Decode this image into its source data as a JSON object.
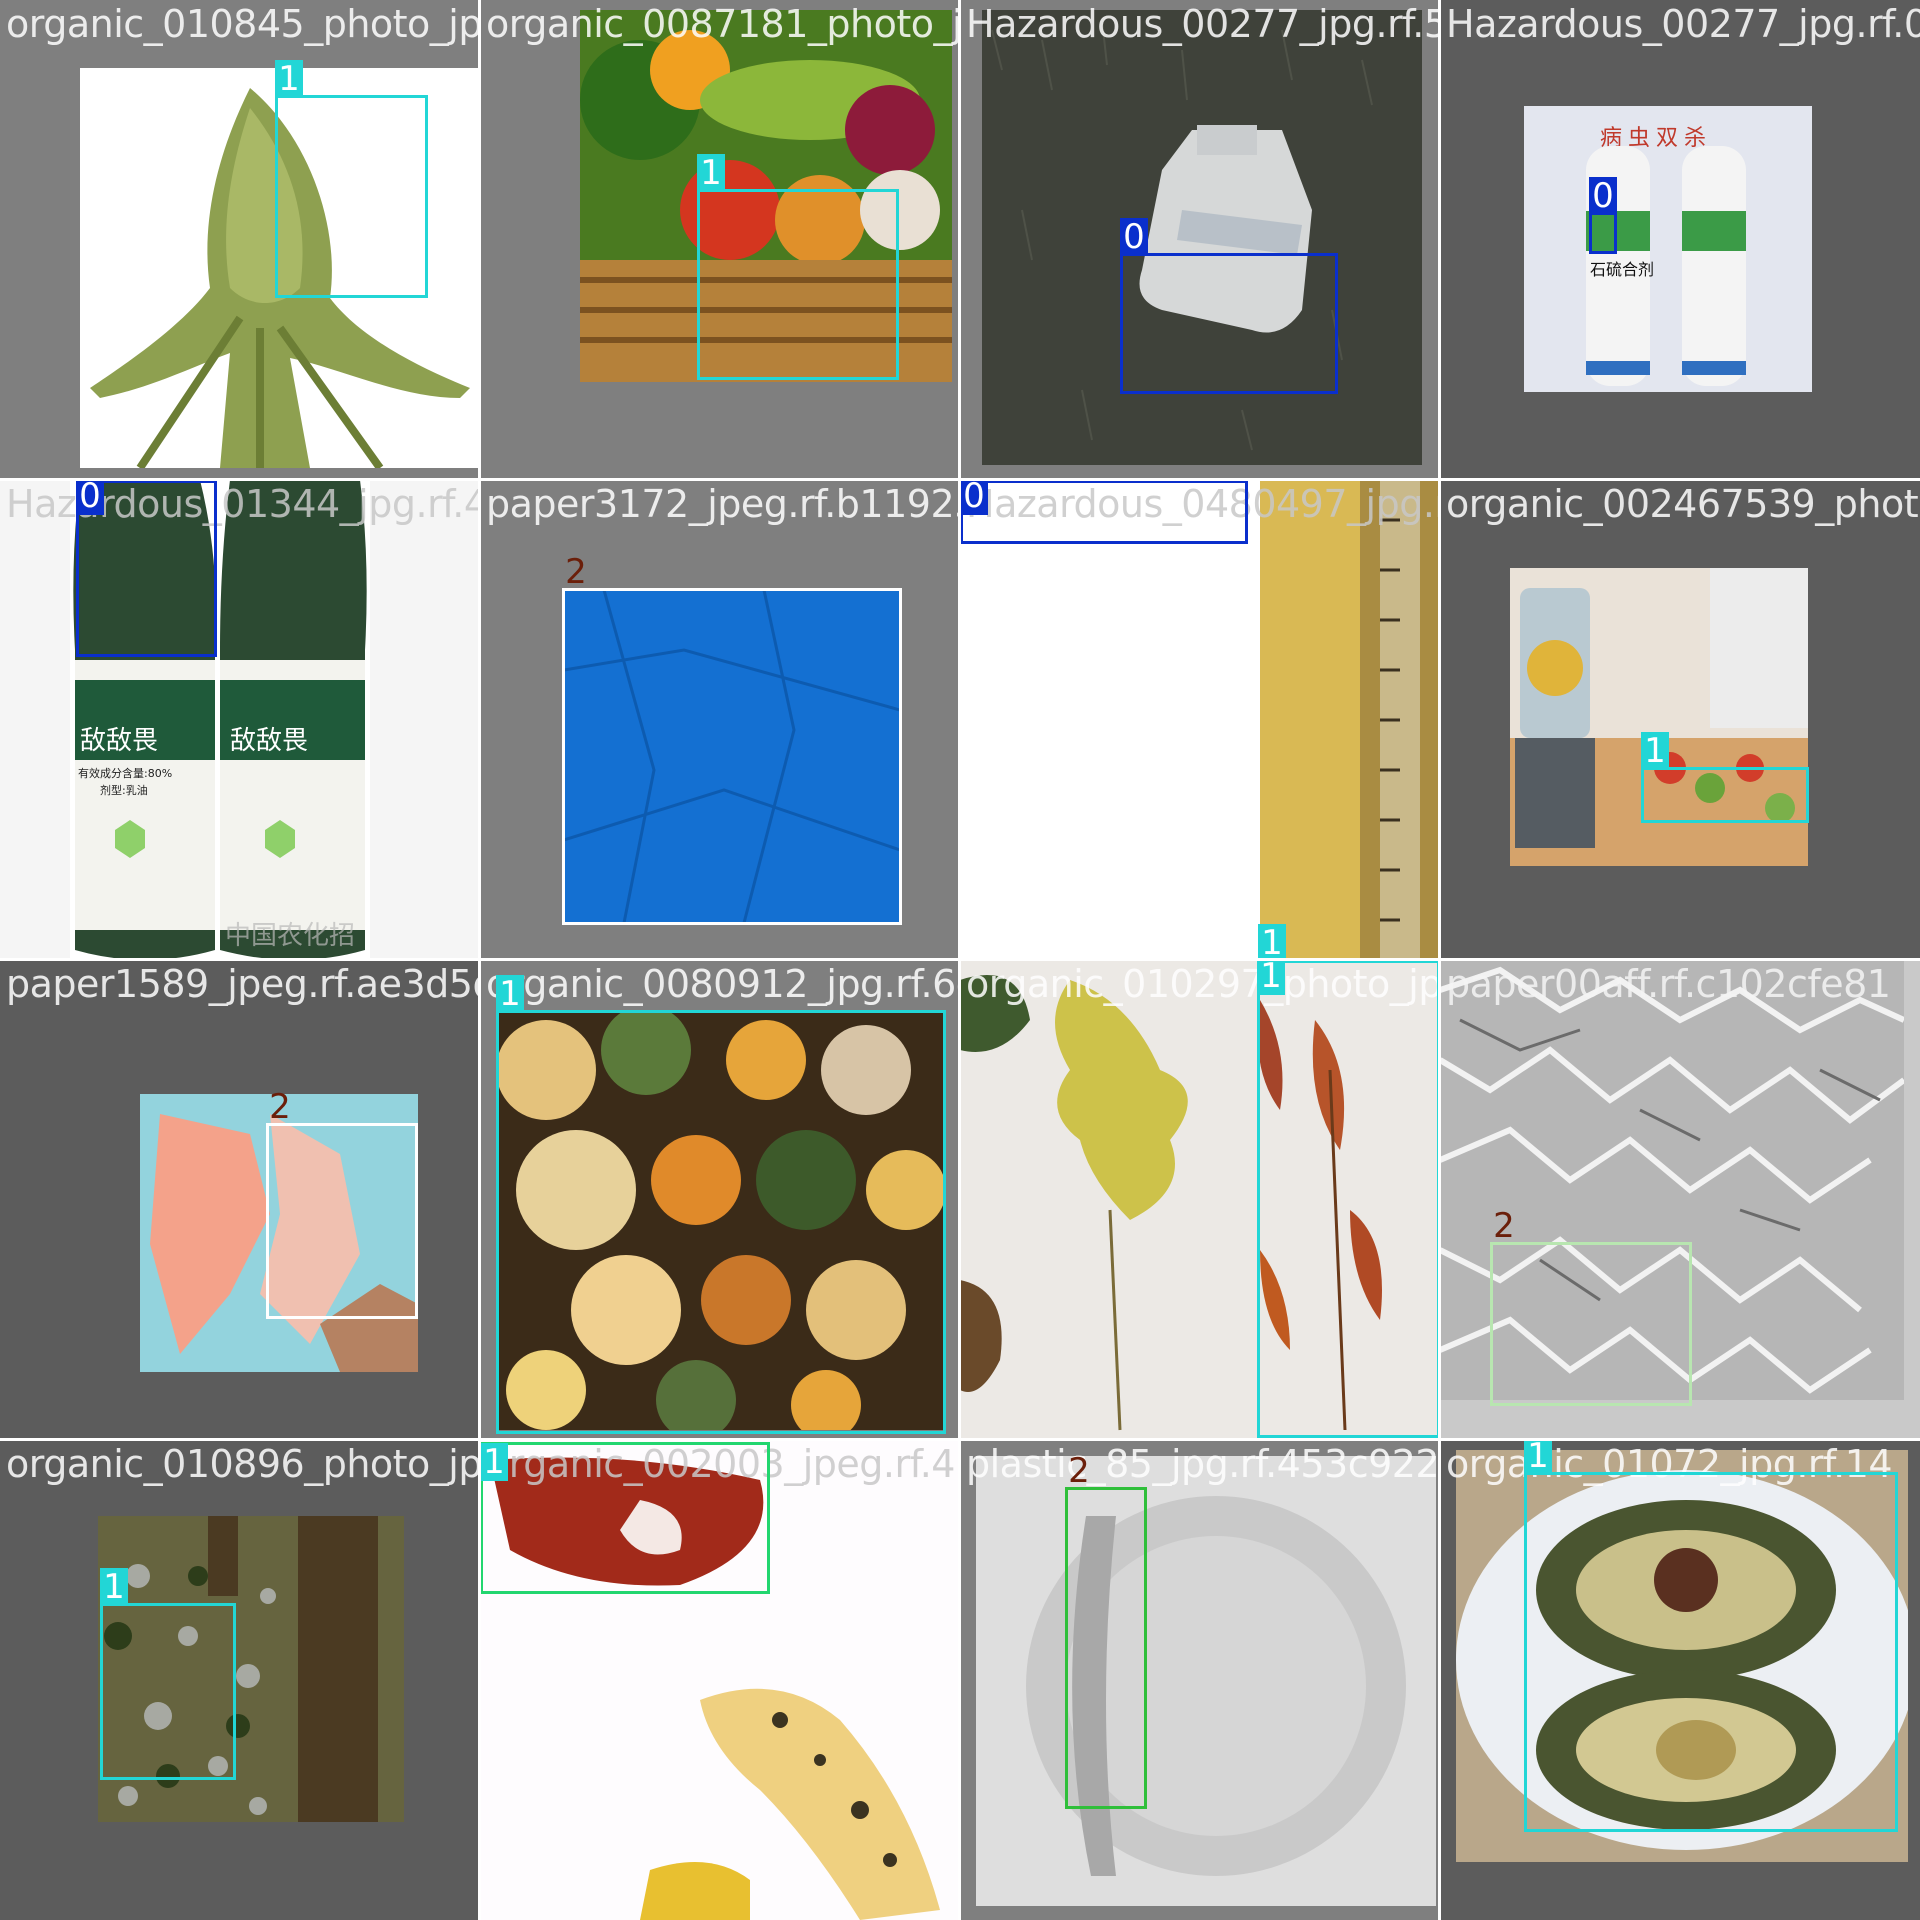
{
  "tiles": [
    {
      "filename": "organic_010845_photo_jpg.rf.cab0b48741f04",
      "boxes": [
        {
          "label": "1"
        }
      ]
    },
    {
      "filename": "organic_0087181_photo_jpg.rf.e8a123",
      "boxes": [
        {
          "label": "1"
        }
      ]
    },
    {
      "filename": "Hazardous_00277_jpg.rf.5c6eae6bb40a63749",
      "boxes": [
        {
          "label": "0"
        }
      ]
    },
    {
      "filename": "Hazardous_00277_jpg.rf.0ec",
      "boxes": [
        {
          "label": "0"
        }
      ],
      "product_text": {
        "headline": "病虫双杀",
        "name": "石硫合剂"
      }
    },
    {
      "filename": "Hazardous_01344_jpg.rf.420c9e5172838a2 1f.b119256",
      "boxes": [
        {
          "label": "0"
        }
      ],
      "product_text": {
        "name": "敌敌畏",
        "content": "有效成分含量:80%",
        "form": "剂型:乳油",
        "watermark": "中国农化招商网"
      }
    },
    {
      "filename": "paper3172_jpeg.rf.b119256f",
      "boxes": [
        {
          "label": "2"
        }
      ]
    },
    {
      "filename": "Hazardous_0480497_jpg.rf.7ec1236d",
      "boxes": [
        {
          "label": "0"
        },
        {
          "label": "1"
        }
      ]
    },
    {
      "filename": "organic_002467539_photo_jpg.r",
      "boxes": [
        {
          "label": "1"
        }
      ]
    },
    {
      "filename": "paper1589_jpeg.rf.ae3d5de1b",
      "boxes": [
        {
          "label": "2"
        }
      ]
    },
    {
      "filename": "organic_0080912_jpg.rf.6d5c853",
      "boxes": [
        {
          "label": "1"
        }
      ]
    },
    {
      "filename": "organic_010297_photo_jpg.",
      "boxes": [
        {
          "label": "1"
        }
      ]
    },
    {
      "filename": "paper00aff.rf.c102cfe81",
      "boxes": [
        {
          "label": "2"
        }
      ]
    },
    {
      "filename": "organic_010896_photo_jpg.r",
      "boxes": [
        {
          "label": "1"
        }
      ]
    },
    {
      "filename": "organic_002003_jpeg.rf.4",
      "boxes": [
        {
          "label": "1"
        }
      ]
    },
    {
      "filename": "plastic_85_jpg.rf.453c92299",
      "boxes": [
        {
          "label": "2"
        }
      ]
    },
    {
      "filename": "organic_01072_jpg.rf.14",
      "boxes": [
        {
          "label": "1"
        }
      ]
    }
  ]
}
